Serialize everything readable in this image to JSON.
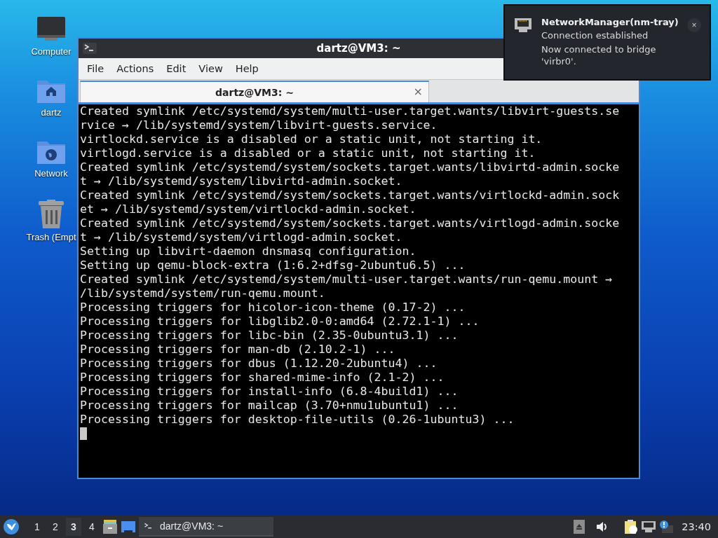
{
  "desktop_icons": [
    {
      "label": "Computer",
      "kind": "computer"
    },
    {
      "label": "dartz",
      "kind": "home"
    },
    {
      "label": "Network",
      "kind": "network"
    },
    {
      "label": "Trash (Empt",
      "kind": "trash"
    }
  ],
  "window": {
    "title": "dartz@VM3: ~",
    "menu": [
      "File",
      "Actions",
      "Edit",
      "View",
      "Help"
    ],
    "tabs": [
      {
        "label": "dartz@VM3: ~",
        "selected": true,
        "close": "×"
      }
    ],
    "terminal_lines": [
      "Created symlink /etc/systemd/system/multi-user.target.wants/libvirt-guests.se",
      "rvice → /lib/systemd/system/libvirt-guests.service.",
      "virtlockd.service is a disabled or a static unit, not starting it.",
      "virtlogd.service is a disabled or a static unit, not starting it.",
      "Created symlink /etc/systemd/system/sockets.target.wants/libvirtd-admin.socke",
      "t → /lib/systemd/system/libvirtd-admin.socket.",
      "Created symlink /etc/systemd/system/sockets.target.wants/virtlockd-admin.sock",
      "et → /lib/systemd/system/virtlockd-admin.socket.",
      "Created symlink /etc/systemd/system/sockets.target.wants/virtlogd-admin.socke",
      "t → /lib/systemd/system/virtlogd-admin.socket.",
      "Setting up libvirt-daemon dnsmasq configuration.",
      "Setting up qemu-block-extra (1:6.2+dfsg-2ubuntu6.5) ...",
      "Created symlink /etc/systemd/system/multi-user.target.wants/run-qemu.mount →",
      "/lib/systemd/system/run-qemu.mount.",
      "Processing triggers for hicolor-icon-theme (0.17-2) ...",
      "Processing triggers for libglib2.0-0:amd64 (2.72.1-1) ...",
      "Processing triggers for libc-bin (2.35-0ubuntu3.1) ...",
      "Processing triggers for man-db (2.10.2-1) ...",
      "Processing triggers for dbus (1.12.20-2ubuntu4) ...",
      "Processing triggers for shared-mime-info (2.1-2) ...",
      "Processing triggers for install-info (6.8-4build1) ...",
      "Processing triggers for mailcap (3.70+nmu1ubuntu1) ...",
      "Processing triggers for desktop-file-utils (0.26-1ubuntu3) ..."
    ]
  },
  "notification": {
    "title": "NetworkManager(nm-tray)",
    "summary": "Connection established",
    "body": "Now connected to bridge 'virbr0'.",
    "close": "×"
  },
  "taskbar": {
    "workspaces": [
      {
        "label": "1",
        "selected": false
      },
      {
        "label": "2",
        "selected": false
      },
      {
        "label": "3",
        "selected": true
      },
      {
        "label": "4",
        "selected": false
      }
    ],
    "tasks": [
      {
        "label": "dartz@VM3: ~",
        "selected": true
      }
    ],
    "clock": "23:40"
  }
}
